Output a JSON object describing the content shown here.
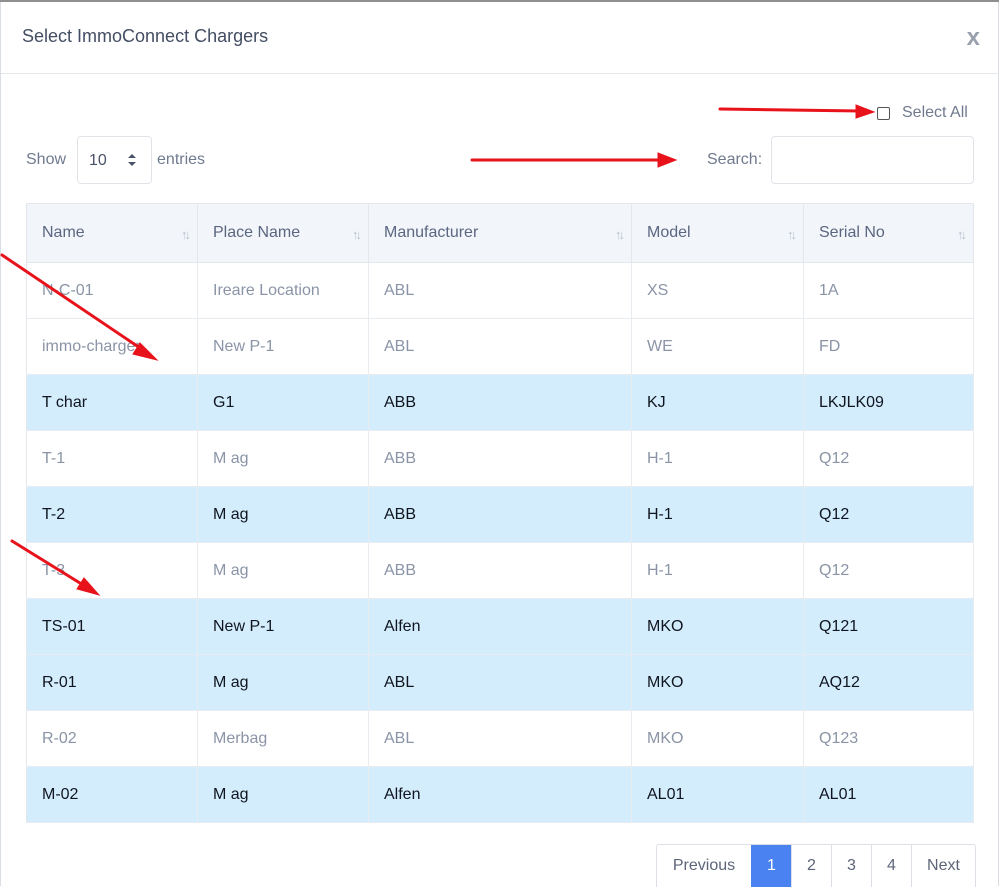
{
  "modal": {
    "title": "Select ImmoConnect Chargers",
    "close_label": "x"
  },
  "select_all": {
    "label": "Select All",
    "checked": false
  },
  "length": {
    "show_label": "Show",
    "value": "10",
    "entries_label": "entries"
  },
  "search": {
    "label": "Search:",
    "value": "",
    "placeholder": ""
  },
  "table": {
    "columns": [
      "Name",
      "Place Name",
      "Manufacturer",
      "Model",
      "Serial No"
    ],
    "rows": [
      {
        "cells": [
          "N-C-01",
          "Ireare Location",
          "ABL",
          "XS",
          "1A"
        ],
        "selected": false
      },
      {
        "cells": [
          "immo-charger",
          "New P-1",
          "ABL",
          "WE",
          "FD"
        ],
        "selected": false
      },
      {
        "cells": [
          "T    char",
          "G1",
          "ABB",
          "KJ",
          "LKJLK09"
        ],
        "selected": true
      },
      {
        "cells": [
          "T-1",
          "M    ag",
          "ABB",
          "H-1",
          "Q12"
        ],
        "selected": false
      },
      {
        "cells": [
          "T-2",
          "M    ag",
          "ABB",
          "H-1",
          "Q12"
        ],
        "selected": true
      },
      {
        "cells": [
          "T-3",
          "M    ag",
          "ABB",
          "H-1",
          "Q12"
        ],
        "selected": false
      },
      {
        "cells": [
          "TS-01",
          "New P-1",
          "Alfen",
          "MKO",
          "Q121"
        ],
        "selected": true
      },
      {
        "cells": [
          "R-01",
          "M    ag",
          "ABL",
          "MKO",
          "AQ12"
        ],
        "selected": true
      },
      {
        "cells": [
          "R-02",
          "Merbag",
          "ABL",
          "MKO",
          "Q123"
        ],
        "selected": false
      },
      {
        "cells": [
          "M-02",
          "M    ag",
          "Alfen",
          "AL01",
          "AL01"
        ],
        "selected": true
      }
    ]
  },
  "pagination": {
    "previous": "Previous",
    "pages": [
      "1",
      "2",
      "3",
      "4"
    ],
    "active": "1",
    "next": "Next"
  },
  "colors": {
    "selected_row": "#d3edfd",
    "active_page": "#4a82f2",
    "annotation_arrow": "#e8121b"
  }
}
